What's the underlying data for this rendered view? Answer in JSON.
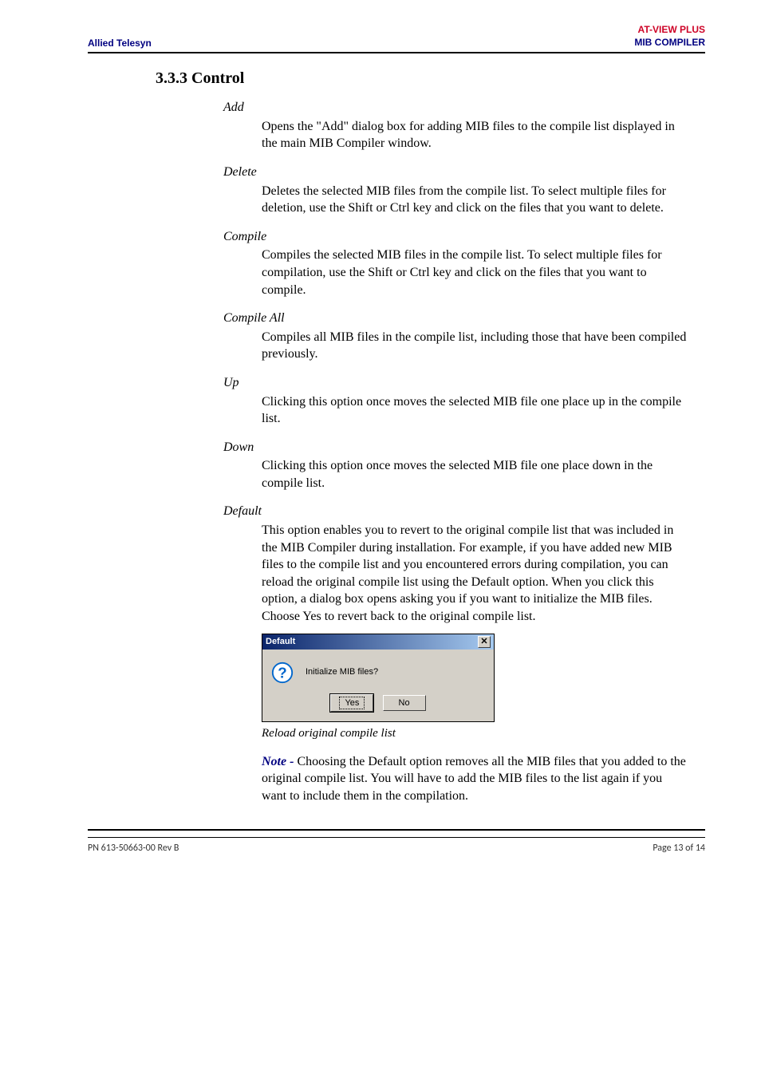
{
  "header": {
    "left": "Allied Telesyn",
    "right_top": "AT-VIEW PLUS",
    "right_bottom": "MIB COMPILER"
  },
  "section": {
    "number_title": "3.3.3 Control"
  },
  "items": {
    "add": {
      "term": "Add",
      "def": "Opens the \"Add\" dialog box for adding MIB files to the compile list displayed in the main MIB Compiler window."
    },
    "delete": {
      "term": "Delete",
      "def": "Deletes the selected MIB files from the compile list. To select multiple files for deletion, use the Shift or Ctrl key and click on the files that you want to delete."
    },
    "compile": {
      "term": "Compile",
      "def": "Compiles the selected MIB files in the compile list. To select multiple files for compilation, use the Shift or Ctrl key and click on the files that you want to compile."
    },
    "compile_all": {
      "term": "Compile All",
      "def": "Compiles all MIB files in the compile list, including those that have been compiled previously."
    },
    "up": {
      "term": "Up",
      "def": "Clicking this option once moves the selected MIB file one place up in the compile list."
    },
    "down": {
      "term": "Down",
      "def": "Clicking this option once moves the selected MIB file one place down in the compile list."
    },
    "default": {
      "term": "Default",
      "def": "This option enables you to revert to the original compile list that was included in the MIB Compiler during installation. For example, if you have added new MIB files to the compile list and you encountered errors during compilation, you can reload the original compile list using the Default option. When you click this option, a dialog box opens asking you if you want to initialize the MIB files. Choose Yes to revert back to the original compile list."
    }
  },
  "dialog": {
    "title": "Default",
    "close_glyph": "✕",
    "message": "Initialize MIB files?",
    "yes": "Yes",
    "no": "No"
  },
  "caption": "Reload original compile list",
  "note": {
    "label": "Note - ",
    "text": "Choosing the Default option removes all the MIB files that you added to the original compile list. You will have to add the MIB files to the list again if you want to include them in the compilation."
  },
  "footer": {
    "left": "PN 613-50663-00 Rev B",
    "right": "Page 13 of 14"
  }
}
